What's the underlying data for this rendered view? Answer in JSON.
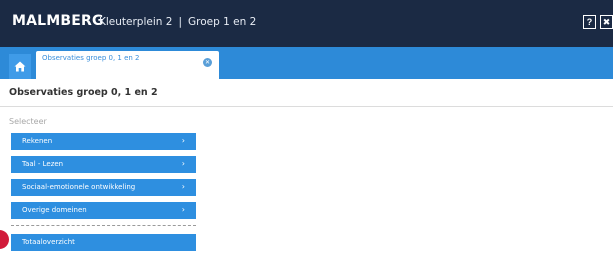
{
  "header": {
    "brand": "MALMBERG",
    "breadcrumb": [
      "Kleuterplein 2",
      "Groep 1 en 2"
    ],
    "separator": "|",
    "help_label": "?",
    "close_label": "✖",
    "colors": {
      "background": "#1b2a44",
      "text": "#ffffff"
    }
  },
  "tabbar": {
    "home_icon": "home-icon",
    "tabs": [
      {
        "label": "Observaties groep 0, 1 en 2",
        "close_icon": "close-circle-icon",
        "active": true
      }
    ],
    "colors": {
      "background": "#2d8ad8",
      "active_tab": "#ffffff"
    }
  },
  "main": {
    "title": "Observaties groep 0, 1 en 2",
    "select_label": "Selecteer",
    "categories": [
      {
        "label": "Rekenen",
        "icon": "chevron-right-icon"
      },
      {
        "label": "Taal - Lezen",
        "icon": "chevron-right-icon"
      },
      {
        "label": "Sociaal-emotionele ontwikkeling",
        "icon": "chevron-right-icon"
      },
      {
        "label": "Overige domeinen",
        "icon": "chevron-right-icon"
      }
    ],
    "summary_button": "Totaaloverzicht",
    "colors": {
      "button": "#2e8fe0",
      "marker": "#d11a3a"
    }
  }
}
